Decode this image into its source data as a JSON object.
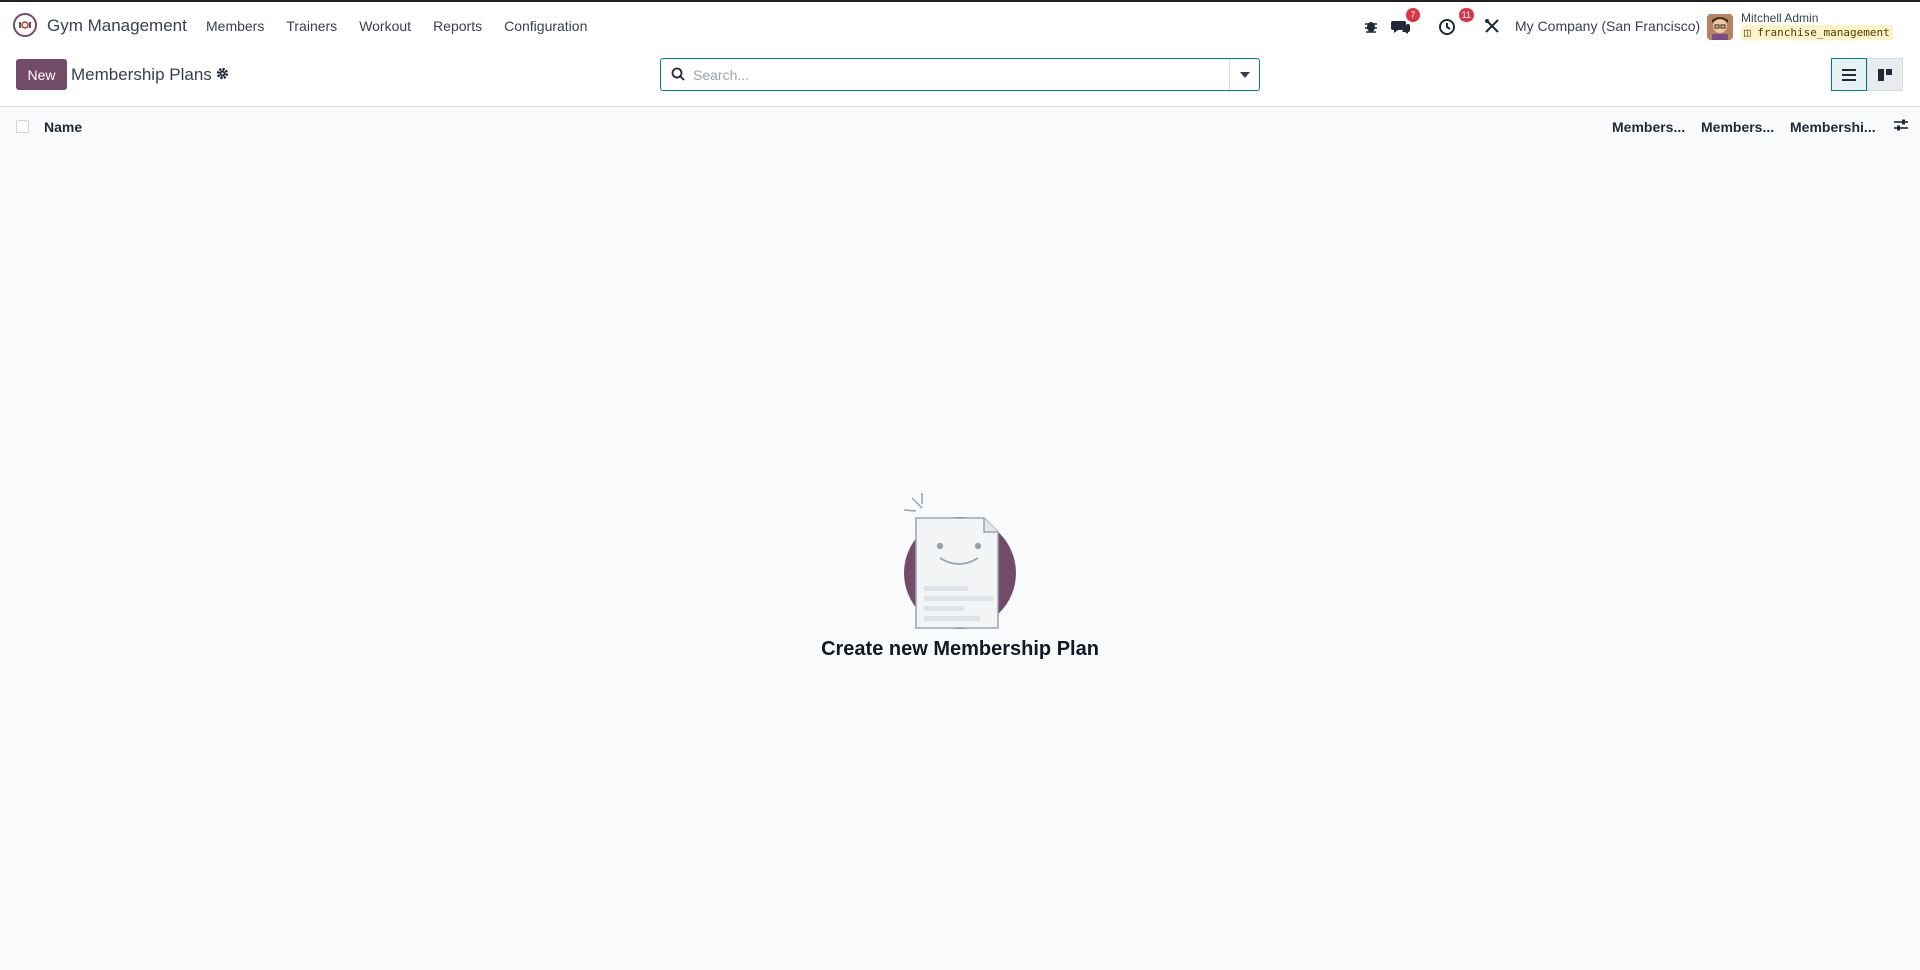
{
  "app": {
    "title": "Gym Management"
  },
  "menu": [
    "Members",
    "Trainers",
    "Workout",
    "Reports",
    "Configuration"
  ],
  "systray": {
    "messages_count": "7",
    "activities_count": "11",
    "company": "My Company (San Francisco)",
    "user_name": "Mitchell Admin",
    "database": "franchise_management"
  },
  "control": {
    "new_label": "New",
    "title": "Membership Plans",
    "search_placeholder": "Search..."
  },
  "list": {
    "columns": [
      "Name",
      "Members...",
      "Members...",
      "Membershi..."
    ]
  },
  "empty": {
    "title": "Create new Membership Plan"
  },
  "colors": {
    "brand": "#714b67",
    "accent": "#017e84",
    "badge": "#dc3545"
  }
}
